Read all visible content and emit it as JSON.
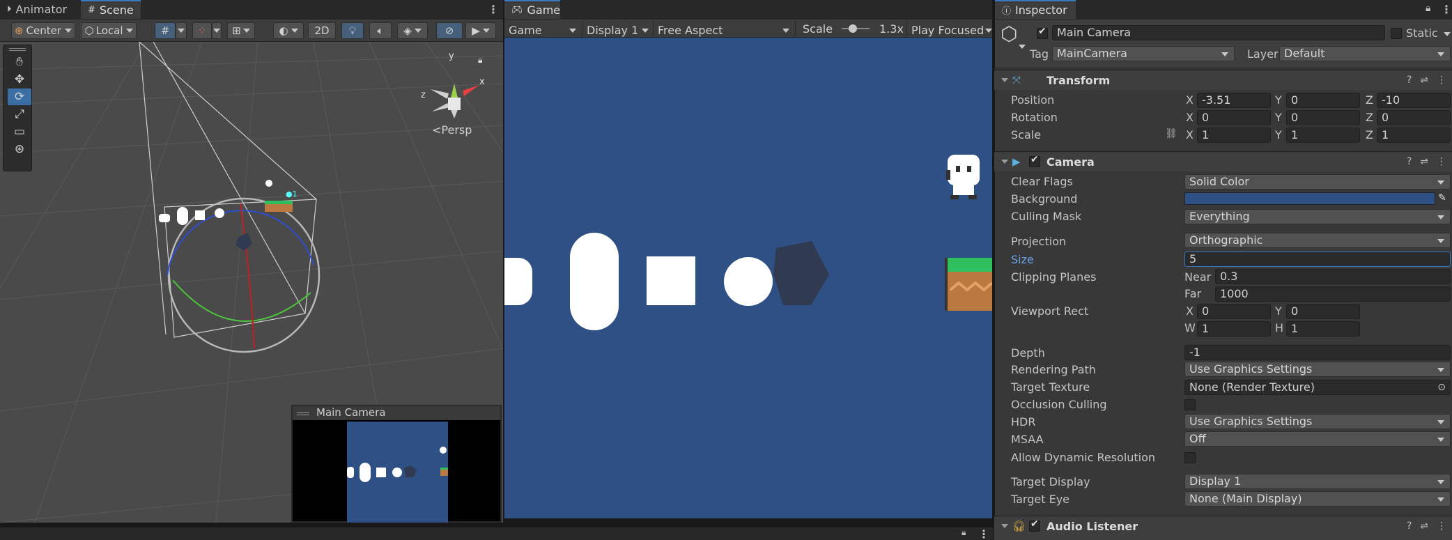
{
  "scene_panel": {
    "tabs": [
      {
        "label": "Animator"
      },
      {
        "label": "Scene"
      }
    ],
    "toolbar": {
      "pivot": "Center",
      "space": "Local",
      "mode_2d": "2D"
    },
    "persp_label": "Persp",
    "gizmo_axes": {
      "y": "y",
      "x": "x",
      "z": "z"
    },
    "camera_preview_title": "Main Camera"
  },
  "game_panel": {
    "tab": "Game",
    "view_dropdown": "Game",
    "display_dropdown": "Display 1",
    "aspect_dropdown": "Free Aspect",
    "scale_label": "Scale",
    "scale_value": "1.3x",
    "scale_fraction": 0.3,
    "play_mode": "Play Focused",
    "background_color": "#2f5084"
  },
  "inspector": {
    "tab": "Inspector",
    "object": {
      "active": true,
      "name": "Main Camera",
      "static_label": "Static",
      "tag_label": "Tag",
      "tag": "MainCamera",
      "layer_label": "Layer",
      "layer": "Default"
    },
    "transform": {
      "title": "Transform",
      "rows": [
        {
          "label": "Position",
          "x": "-3.51",
          "y": "0",
          "z": "-10"
        },
        {
          "label": "Rotation",
          "x": "0",
          "y": "0",
          "z": "0"
        },
        {
          "label": "Scale",
          "x": "1",
          "y": "1",
          "z": "1"
        }
      ]
    },
    "camera": {
      "title": "Camera",
      "enabled": true,
      "clear_flags": {
        "label": "Clear Flags",
        "value": "Solid Color"
      },
      "background": {
        "label": "Background",
        "color": "#2f5084"
      },
      "culling_mask": {
        "label": "Culling Mask",
        "value": "Everything"
      },
      "projection": {
        "label": "Projection",
        "value": "Orthographic"
      },
      "size": {
        "label": "Size",
        "value": "5"
      },
      "clipping": {
        "label": "Clipping Planes",
        "near_label": "Near",
        "near": "0.3",
        "far_label": "Far",
        "far": "1000"
      },
      "viewport": {
        "label": "Viewport Rect",
        "x": "0",
        "y": "0",
        "w": "1",
        "h": "1"
      },
      "depth": {
        "label": "Depth",
        "value": "-1"
      },
      "rendering_path": {
        "label": "Rendering Path",
        "value": "Use Graphics Settings"
      },
      "target_texture": {
        "label": "Target Texture",
        "value": "None (Render Texture)"
      },
      "occlusion_culling": {
        "label": "Occlusion Culling",
        "checked": false
      },
      "hdr": {
        "label": "HDR",
        "value": "Use Graphics Settings"
      },
      "msaa": {
        "label": "MSAA",
        "value": "Off"
      },
      "dynamic_resolution": {
        "label": "Allow Dynamic Resolution",
        "checked": false
      },
      "target_display": {
        "label": "Target Display",
        "value": "Display 1"
      },
      "target_eye": {
        "label": "Target Eye",
        "value": "None (Main Display)"
      }
    },
    "audio_listener": {
      "title": "Audio Listener",
      "enabled": true
    }
  },
  "colors": {
    "accent": "#3a79bb",
    "focus_label": "#6aa2e8",
    "panel": "#383838"
  }
}
